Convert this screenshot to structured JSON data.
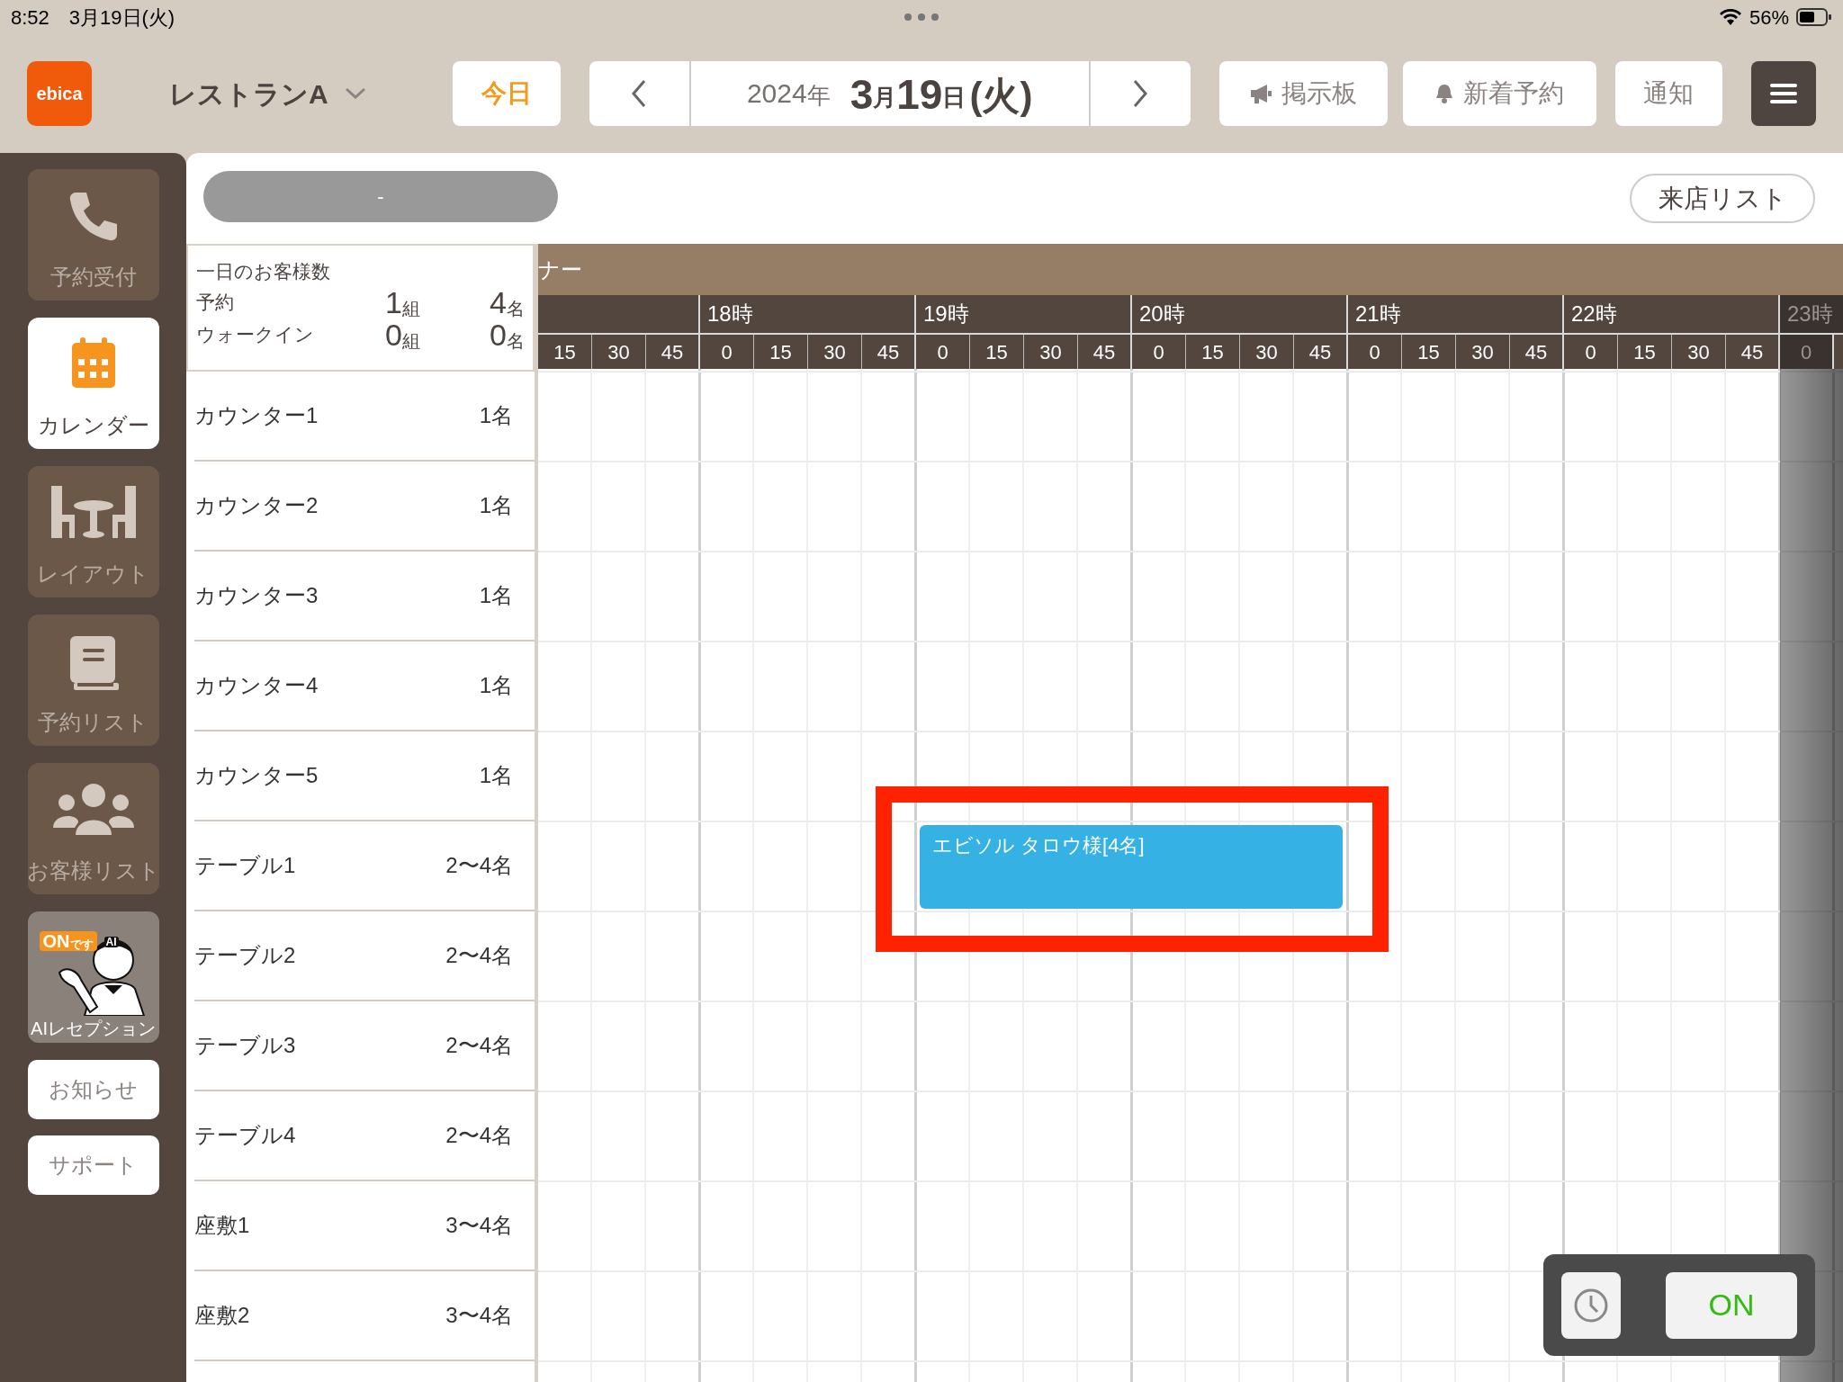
{
  "status_bar": {
    "time": "8:52",
    "date": "3月19日(火)",
    "battery": "56%"
  },
  "header": {
    "logo": "ebica",
    "restaurant": "レストランA",
    "today": "今日",
    "date_parts": [
      {
        "text": "2024",
        "kind": "year"
      },
      {
        "text": "年",
        "kind": "year_unit"
      },
      {
        "text": "3",
        "kind": "number"
      },
      {
        "text": "月",
        "kind": "unit"
      },
      {
        "text": "19",
        "kind": "number"
      },
      {
        "text": "日",
        "kind": "unit"
      },
      {
        "text": "(火)",
        "kind": "weekday"
      }
    ],
    "buttons": [
      {
        "label": "掲示板",
        "kind": "megaphone"
      },
      {
        "label": "新着予約",
        "kind": "bell"
      },
      {
        "label": "通知",
        "kind": "plain"
      }
    ]
  },
  "sidebar": {
    "items": [
      {
        "label": "予約受付",
        "kind": "phone",
        "selected": false
      },
      {
        "label": "カレンダー",
        "kind": "calendar",
        "selected": true
      },
      {
        "label": "レイアウト",
        "kind": "layout",
        "selected": false
      },
      {
        "label": "予約リスト",
        "kind": "book",
        "selected": false
      },
      {
        "label": "お客様リスト",
        "kind": "people",
        "selected": false
      },
      {
        "label": "AIレセプション",
        "kind": "ai",
        "selected": false,
        "bubble": "ON",
        "bubble_sub": "です",
        "cap": "AI"
      }
    ],
    "buttons": [
      "お知らせ",
      "サポート"
    ]
  },
  "toolbar": {
    "pill": "-",
    "visit_list": "来店リスト"
  },
  "summary": {
    "title": "一日のお客様数",
    "rows": [
      {
        "label": "予約",
        "groups": "1",
        "groups_unit": "組",
        "people": "4",
        "people_unit": "名"
      },
      {
        "label": "ウォークイン",
        "groups": "0",
        "groups_unit": "組",
        "people": "0",
        "people_unit": "名"
      }
    ]
  },
  "area_band": "ナー",
  "hours": [
    {
      "minutes": [
        "15",
        "30",
        "45"
      ]
    },
    {
      "label": "18時",
      "minutes": [
        "0",
        "15",
        "30",
        "45"
      ]
    },
    {
      "label": "19時",
      "minutes": [
        "0",
        "15",
        "30",
        "45"
      ]
    },
    {
      "label": "20時",
      "minutes": [
        "0",
        "15",
        "30",
        "45"
      ]
    },
    {
      "label": "21時",
      "minutes": [
        "0",
        "15",
        "30",
        "45"
      ]
    },
    {
      "label": "22時",
      "minutes": [
        "0",
        "15",
        "30",
        "45"
      ]
    },
    {
      "label": "23時",
      "minutes": [
        "0"
      ]
    }
  ],
  "seats": [
    {
      "name": "カウンター1",
      "capacity": "1名"
    },
    {
      "name": "カウンター2",
      "capacity": "1名"
    },
    {
      "name": "カウンター3",
      "capacity": "1名"
    },
    {
      "name": "カウンター4",
      "capacity": "1名"
    },
    {
      "name": "カウンター5",
      "capacity": "1名"
    },
    {
      "name": "テーブル1",
      "capacity": "2〜4名"
    },
    {
      "name": "テーブル2",
      "capacity": "2〜4名"
    },
    {
      "name": "テーブル3",
      "capacity": "2〜4名"
    },
    {
      "name": "テーブル4",
      "capacity": "2〜4名"
    },
    {
      "name": "座敷1",
      "capacity": "3〜4名"
    },
    {
      "name": "座敷2",
      "capacity": "3〜4名"
    }
  ],
  "reservations": [
    {
      "label": "エビソル タロウ様[4名]",
      "highlighted": true
    }
  ],
  "float_panel": {
    "toggle": "ON",
    "on": true
  }
}
